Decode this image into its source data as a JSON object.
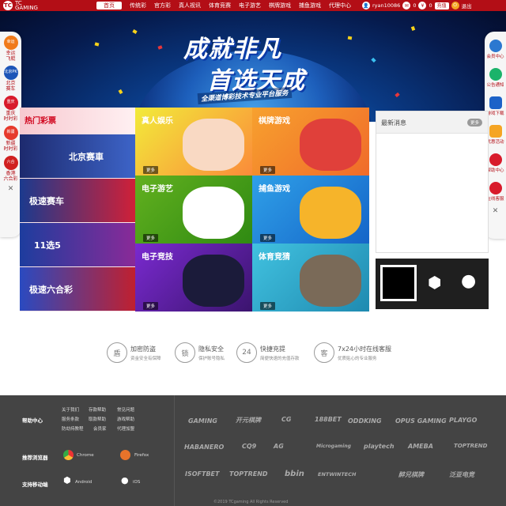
{
  "header": {
    "logo_mark": "TC",
    "logo_text": "TC\nGAMING",
    "nav": [
      "首页",
      "传统彩",
      "官方彩",
      "真人视讯",
      "体育竞赛",
      "电子游艺",
      "棋牌游戏",
      "捕鱼游戏",
      "代理中心"
    ],
    "username": "ryan10086",
    "badge_count": "0",
    "balance": "0",
    "deposit_label": "充值",
    "logout_label": "退出"
  },
  "banner": {
    "line1": "成就非凡",
    "line2": "首选天成",
    "sub": "全渠道博彩技术专业平台服务"
  },
  "left_sidebar": {
    "items": [
      {
        "icon": "幸运",
        "label": "幸运\n飞艇",
        "color": "#f07a1a"
      },
      {
        "icon": "北京PK",
        "label": "北京\n赛车",
        "color": "#1c55b8"
      },
      {
        "icon": "重庆",
        "label": "重庆\n时时彩",
        "color": "#d81b2b"
      },
      {
        "icon": "新疆",
        "label": "新疆\n时时彩",
        "color": "#e63a2c"
      },
      {
        "icon": "六合",
        "label": "香港\n六合彩",
        "color": "#d02020"
      }
    ]
  },
  "right_sidebar": {
    "items": [
      {
        "label": "会员中心",
        "color": "#2b78d0"
      },
      {
        "label": "公告通知",
        "color": "#1bb36a"
      },
      {
        "label": "游戏下载",
        "color": "#1c62c8"
      },
      {
        "label": "优惠活动",
        "color": "#f5a524"
      },
      {
        "label": "帮助中心",
        "color": "#d81b2b"
      },
      {
        "label": "在线客服",
        "color": "#d81b2b"
      }
    ]
  },
  "lotto": {
    "title": "热门彩票",
    "items": [
      {
        "label": "北京赛車",
        "color1": "#1d2a6e",
        "color2": "#3d64c8"
      },
      {
        "label": "极速赛车",
        "color1": "#1b3a8e",
        "color2": "#d02038"
      },
      {
        "label": "11选5",
        "color1": "#1d3d9e",
        "color2": "#8a2a98"
      },
      {
        "label": "极速六合彩",
        "color1": "#2a4ac0",
        "color2": "#c02030"
      }
    ]
  },
  "tiles": [
    {
      "title": "真人娱乐",
      "more": "更多",
      "bg1": "#f2eb3a",
      "bg2": "#fb8b3a",
      "art": "#f9d9c3"
    },
    {
      "title": "棋牌游戏",
      "more": "更多",
      "bg1": "#f7a12e",
      "bg2": "#f06b2a",
      "art": "#e0403a"
    },
    {
      "title": "电子游艺",
      "more": "更多",
      "bg1": "#62b01f",
      "bg2": "#2f8a12",
      "art": "#fff"
    },
    {
      "title": "捕鱼游戏",
      "more": "更多",
      "bg1": "#2fa0e8",
      "bg2": "#1565c8",
      "art": "#f6b42a"
    },
    {
      "title": "电子竞技",
      "more": "更多",
      "bg1": "#7a2ad0",
      "bg2": "#3b146e",
      "art": "#1b1b3a"
    },
    {
      "title": "体育竞猜",
      "more": "更多",
      "bg1": "#41c2e0",
      "bg2": "#1f8ab0",
      "art": "#7a6a58"
    }
  ],
  "news": {
    "title": "最新消息",
    "more": "更多"
  },
  "features": [
    {
      "icon": "盾",
      "title": "加密防盗",
      "sub": "资金安全有保障"
    },
    {
      "icon": "锁",
      "title": "隐私安全",
      "sub": "保护账号隐私"
    },
    {
      "icon": "24",
      "title": "快捷充提",
      "sub": "简便快速的充值存款"
    },
    {
      "icon": "客",
      "title": "7x24小时在线客服",
      "sub": "优质贴心的专业服务"
    }
  ],
  "footer": {
    "help_label": "帮助中心",
    "links": [
      "关于我们",
      "存款帮助",
      "常见问题",
      "服务条款",
      "取款帮助",
      "游戏帮助",
      "防劫持教程",
      "会员家",
      "代理加盟"
    ],
    "browser_label": "推荐浏览器",
    "browsers": [
      "Chrome",
      "Firefox"
    ],
    "mobile_label": "支持移动端",
    "mobile": [
      "Android",
      "iOS"
    ],
    "brands": [
      "GAMING",
      "开元棋牌",
      "CG",
      "188BET",
      "ODDKING",
      "OPUS GAMING",
      "PLAYGO",
      "HABANERO",
      "CQ9",
      "AG",
      "Microgaming",
      "playtech",
      "AMEBA",
      "TOPTREND",
      "ISOFTBET",
      "TOPTREND",
      "bbin",
      "ENTWINTECH",
      "醉兄棋牌",
      "泛亚电竞"
    ],
    "copyright": "©2019 TCgaming All Rights Reserved"
  }
}
